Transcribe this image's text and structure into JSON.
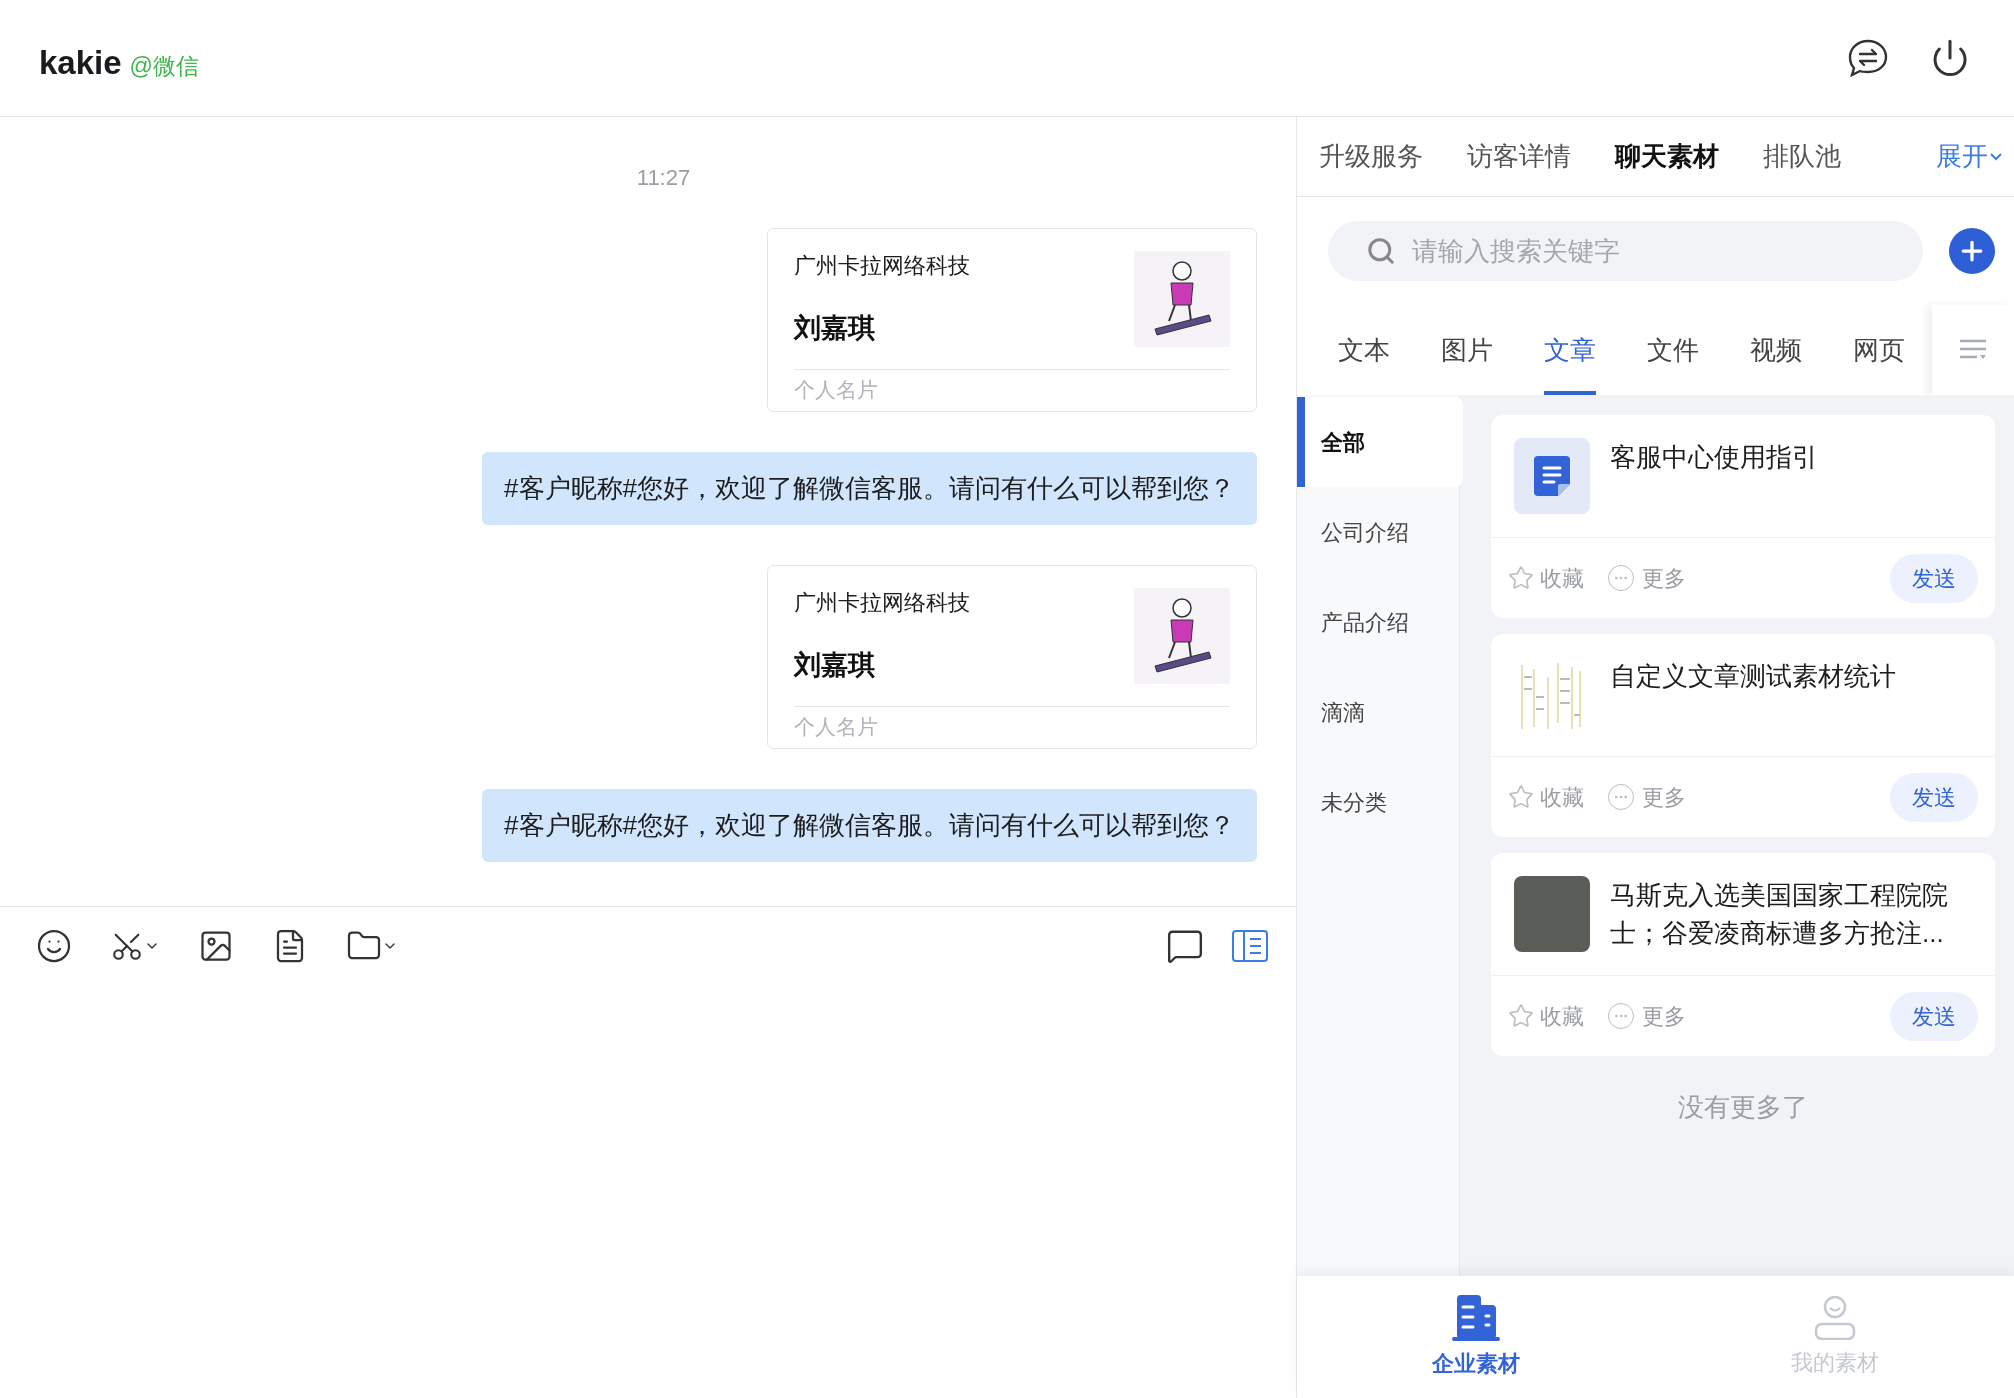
{
  "header": {
    "name": "kakie",
    "source": "@微信"
  },
  "chat": {
    "time": "11:27",
    "messages": [
      {
        "kind": "card",
        "company": "广州卡拉网络科技",
        "person": "刘嘉琪",
        "label": "个人名片"
      },
      {
        "kind": "text",
        "text": "#客户昵称#您好，欢迎了解微信客服。请问有什么可以帮到您？"
      },
      {
        "kind": "card",
        "company": "广州卡拉网络科技",
        "person": "刘嘉琪",
        "label": "个人名片"
      },
      {
        "kind": "text",
        "text": "#客户昵称#您好，欢迎了解微信客服。请问有什么可以帮到您？"
      }
    ]
  },
  "toolbar": {
    "side_panel_on": true
  },
  "side": {
    "tabs": [
      {
        "label": "升级服务",
        "selected": false
      },
      {
        "label": "访客详情",
        "selected": false
      },
      {
        "label": "聊天素材",
        "selected": true
      },
      {
        "label": "排队池",
        "selected": false
      }
    ],
    "expand": "展开",
    "search": {
      "placeholder": "请输入搜索关键字"
    },
    "material_tabs": [
      {
        "label": "文本",
        "selected": false
      },
      {
        "label": "图片",
        "selected": false
      },
      {
        "label": "文章",
        "selected": true
      },
      {
        "label": "文件",
        "selected": false
      },
      {
        "label": "视频",
        "selected": false
      },
      {
        "label": "网页",
        "selected": false
      }
    ],
    "categories": [
      {
        "label": "全部",
        "selected": true
      },
      {
        "label": "公司介绍",
        "selected": false
      },
      {
        "label": "产品介绍",
        "selected": false
      },
      {
        "label": "滴滴",
        "selected": false
      },
      {
        "label": "未分类",
        "selected": false
      }
    ],
    "articles": [
      {
        "kind": "doc",
        "title": "客服中心使用指引",
        "favorite": "收藏",
        "more": "更多",
        "send": "发送"
      },
      {
        "kind": "screenshot",
        "title": "自定义文章测试素材统计",
        "favorite": "收藏",
        "more": "更多",
        "send": "发送"
      },
      {
        "kind": "photo",
        "title": "马斯克入选美国国家工程院院士；谷爱凌商标遭多方抢注...",
        "favorite": "收藏",
        "more": "更多",
        "send": "发送"
      }
    ],
    "end_text": "没有更多了",
    "bottom_nav": [
      {
        "kind": "company",
        "label": "企业素材",
        "selected": true
      },
      {
        "kind": "mine",
        "label": "我的素材",
        "selected": false
      }
    ]
  }
}
